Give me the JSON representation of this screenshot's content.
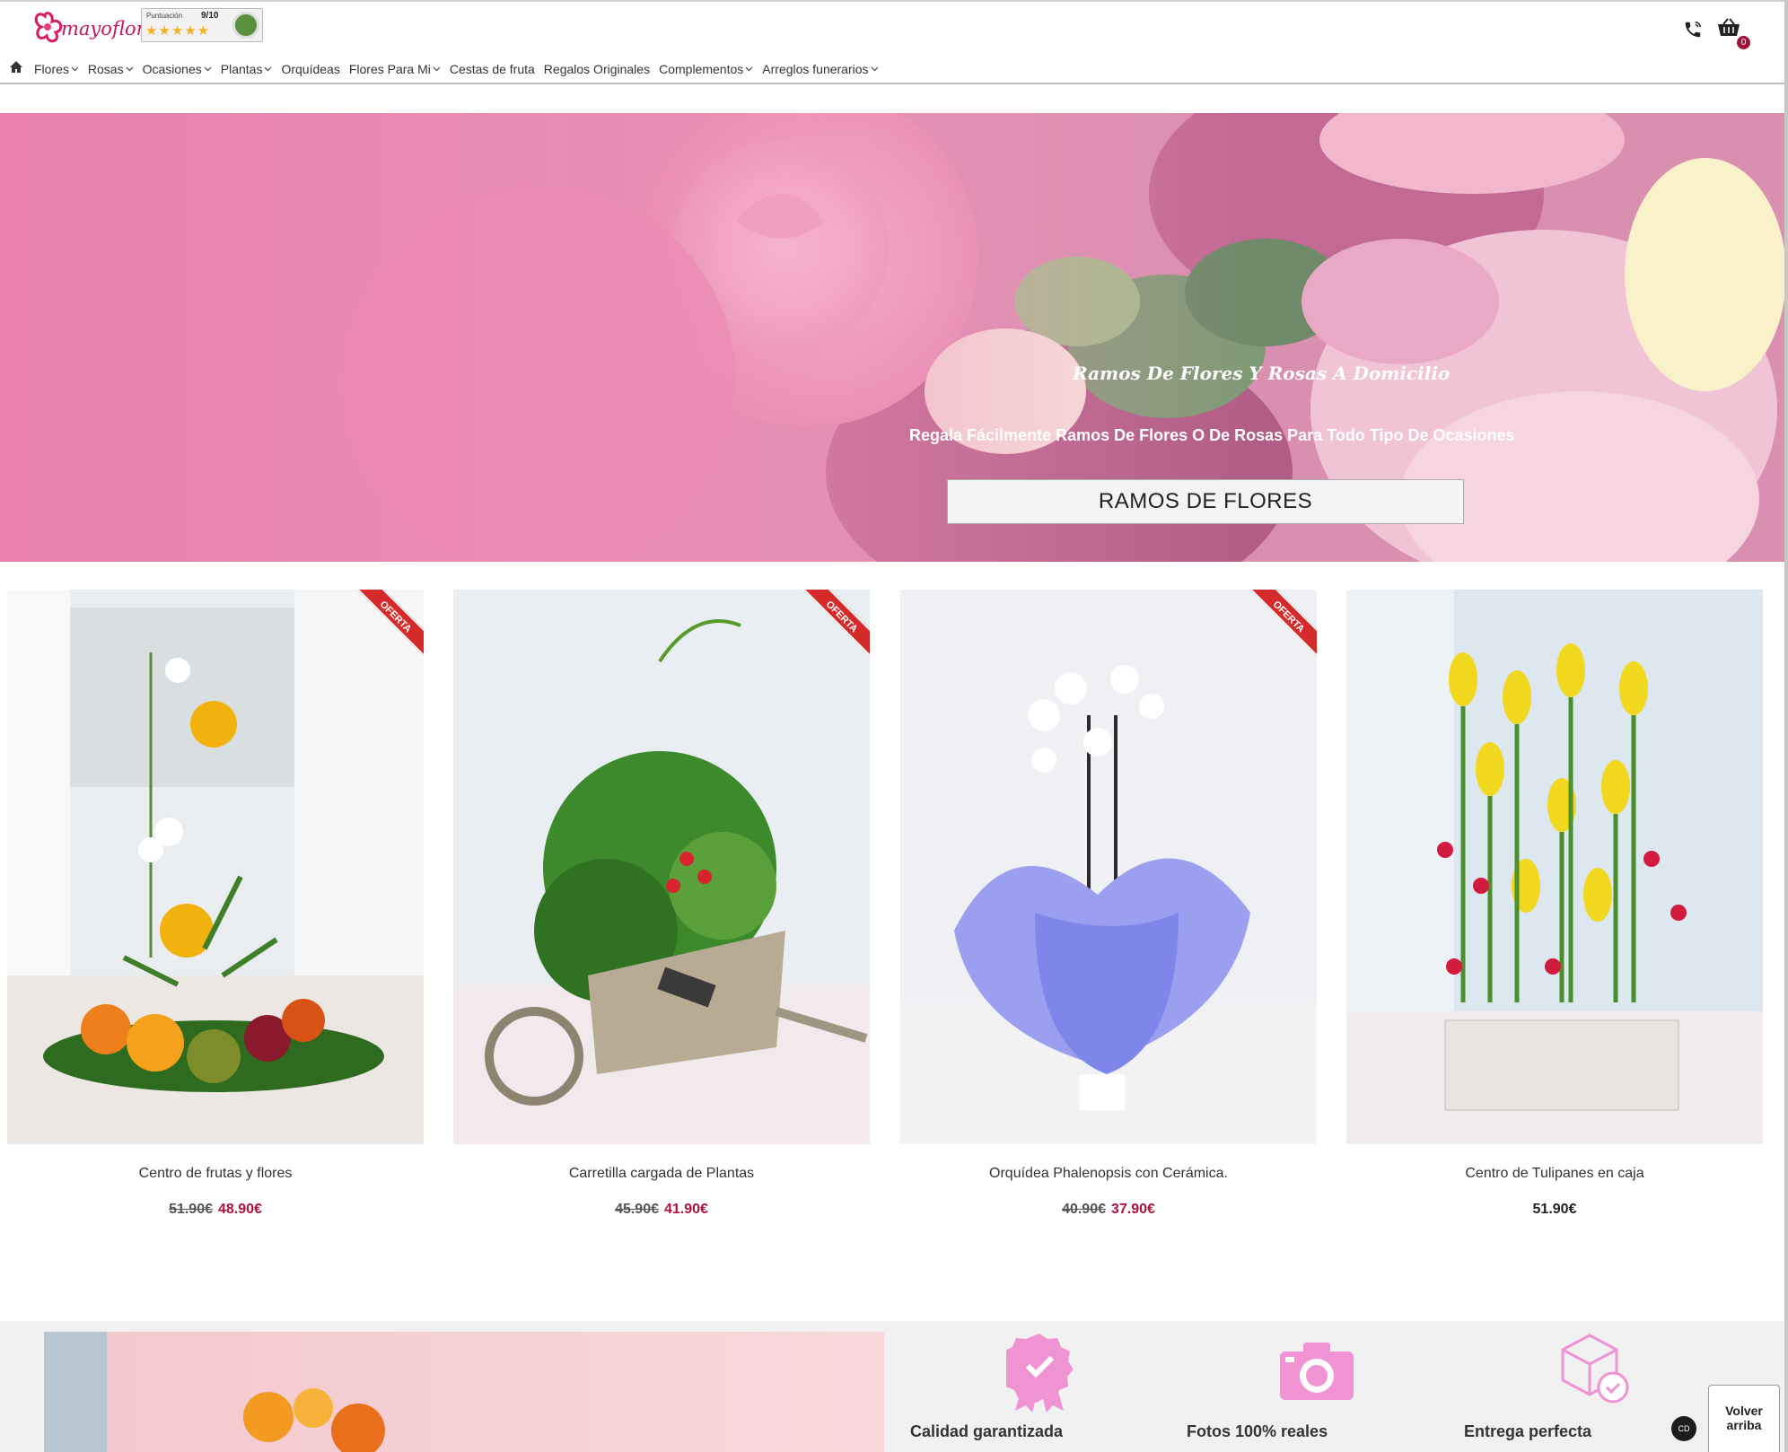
{
  "brand": {
    "logo_text": "mayoflor"
  },
  "rating": {
    "label": "Puntuación",
    "score": "9/10",
    "stars": "★★★★★"
  },
  "header": {
    "cart_count": "0"
  },
  "nav": {
    "items": [
      {
        "label": "Flores",
        "dropdown": true
      },
      {
        "label": "Rosas",
        "dropdown": true
      },
      {
        "label": "Ocasiones",
        "dropdown": true
      },
      {
        "label": "Plantas",
        "dropdown": true
      },
      {
        "label": "Orquídeas",
        "dropdown": false
      },
      {
        "label": "Flores Para Mi",
        "dropdown": true
      },
      {
        "label": "Cestas de fruta",
        "dropdown": false
      },
      {
        "label": "Regalos Originales",
        "dropdown": false
      },
      {
        "label": "Complementos",
        "dropdown": true
      },
      {
        "label": "Arreglos funerarios",
        "dropdown": true
      }
    ]
  },
  "hero": {
    "tagline": "Ramos De Flores Y Rosas A Domicilio",
    "subtitle": "Regala Fácilmente Ramos De Flores O De Rosas Para Todo Tipo De Ocasiones",
    "button": "RAMOS DE FLORES"
  },
  "products": [
    {
      "name": "Centro de frutas y flores",
      "old_price": "51.90€",
      "price": "48.90€",
      "ribbon": "OFERTA"
    },
    {
      "name": "Carretilla cargada de Plantas",
      "old_price": "45.90€",
      "price": "41.90€",
      "ribbon": "OFERTA"
    },
    {
      "name": "Orquídea Phalenopsis con Cerámica.",
      "old_price": "40.90€",
      "price": "37.90€",
      "ribbon": "OFERTA"
    },
    {
      "name": "Centro de Tulipanes en caja",
      "old_price": "",
      "price": "51.90€",
      "ribbon": ""
    }
  ],
  "features": [
    {
      "label": "Calidad garantizada",
      "icon": "quality-badge-icon"
    },
    {
      "label": "Fotos 100% reales",
      "icon": "camera-icon"
    },
    {
      "label": "Entrega perfecta",
      "icon": "delivery-box-icon"
    }
  ],
  "back_to_top": "Volver arriba",
  "chat_icon_text": "CD",
  "colors": {
    "accent": "#b0123c",
    "pink": "#e986c5",
    "offer_ribbon": "#d42a2a"
  }
}
